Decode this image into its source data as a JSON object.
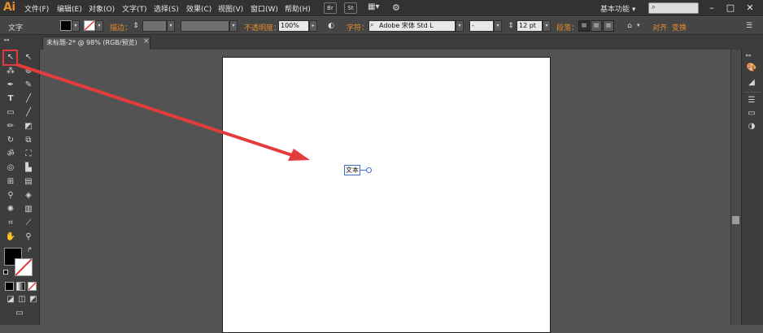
{
  "app": {
    "logo": "Ai"
  },
  "menus": [
    "文件(F)",
    "编辑(E)",
    "对象(O)",
    "文字(T)",
    "选择(S)",
    "效果(C)",
    "视图(V)",
    "窗口(W)",
    "帮助(H)"
  ],
  "menubar_buttons": [
    "Br",
    "St"
  ],
  "workspace": "基本功能 ▾",
  "control_bar": {
    "context_label": "文字",
    "stroke_label": "描边：",
    "opacity_label": "不透明度：",
    "opacity_value": "100%",
    "font_label": "字符：",
    "font_value": "Adobe 宋体 Std L",
    "font_style_value": "-",
    "font_size_value": "12 pt",
    "paragraph_label": "段落：",
    "align_label": "对齐",
    "transform_label": "变换"
  },
  "document_tab": {
    "title": "未标题-2* @ 98% (RGB/预览)",
    "close": "×"
  },
  "canvas_text": "文本",
  "window_buttons": [
    "–",
    "□",
    "✕"
  ],
  "colors": {
    "accent": "#e58c2a",
    "highlight": "#e03a3a",
    "selection": "#3b6fd6"
  }
}
